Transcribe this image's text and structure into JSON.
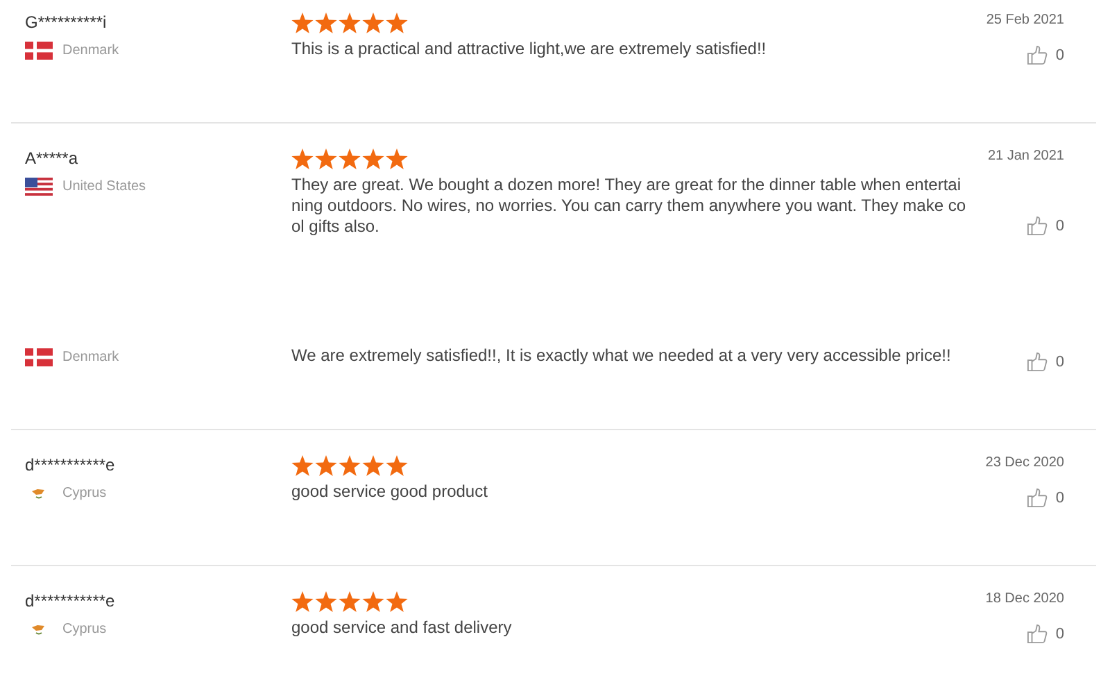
{
  "reviews": [
    {
      "name": "G**********i",
      "country": "Denmark",
      "kind": "denmark",
      "stars": 5,
      "text": "This is a practical and attractive light,we are extremely satisfied!!",
      "date": "25 Feb 2021",
      "likes": "0",
      "divider": true
    },
    {
      "name": "A*****a",
      "country": "United States",
      "kind": "usa",
      "stars": 5,
      "text": "They are great. We bought a dozen more! They are great for the dinner table when entertaining outdoors. No wires, no worries. You can carry them anywhere you want. They make cool gifts also.",
      "date": "21 Jan 2021",
      "likes": "0",
      "divider": false
    },
    {
      "country": "Denmark",
      "kind": "denmark",
      "text": "We are extremely satisfied!!, It is exactly what we needed at a very very accessible price!!",
      "likes": "0",
      "divider": true
    },
    {
      "name": "d***********e",
      "country": "Cyprus",
      "kind": "cyprus",
      "stars": 5,
      "text": "good service good product",
      "date": "23 Dec 2020",
      "likes": "0",
      "divider": true
    },
    {
      "name": "d***********e",
      "country": "Cyprus",
      "kind": "cyprus",
      "stars": 5,
      "text": "good service and fast delivery",
      "date": "18 Dec 2020",
      "likes": "0"
    }
  ]
}
